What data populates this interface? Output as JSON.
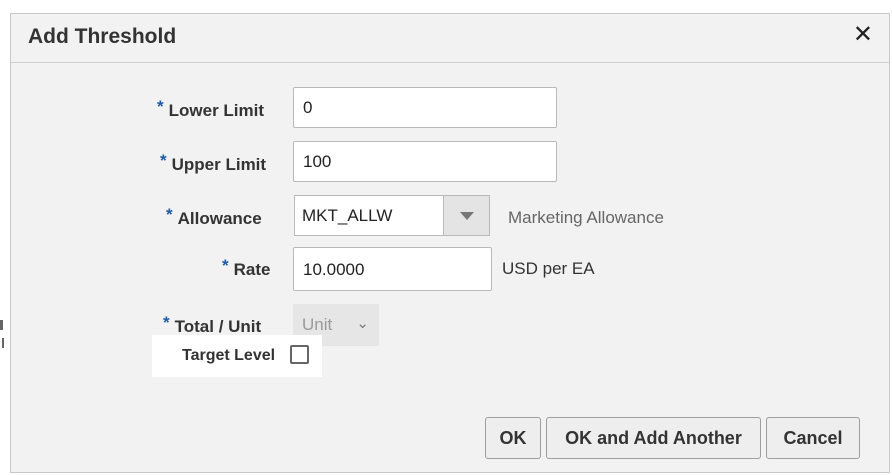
{
  "dialog": {
    "title": "Add Threshold",
    "close_icon": "close-icon"
  },
  "form": {
    "required_marker": "*",
    "lower_limit": {
      "label": "Lower Limit",
      "value": "0"
    },
    "upper_limit": {
      "label": "Upper Limit",
      "value": "100"
    },
    "allowance": {
      "label": "Allowance",
      "value": "MKT_ALLW",
      "description": "Marketing Allowance"
    },
    "rate": {
      "label": "Rate",
      "value": "10.0000",
      "unit": "USD per EA"
    },
    "total_unit": {
      "label": "Total / Unit",
      "selected": "Unit"
    },
    "target_level": {
      "label": "Target Level",
      "checked": false
    }
  },
  "buttons": {
    "ok": "OK",
    "ok_add_another": "OK and Add Another",
    "cancel": "Cancel"
  }
}
